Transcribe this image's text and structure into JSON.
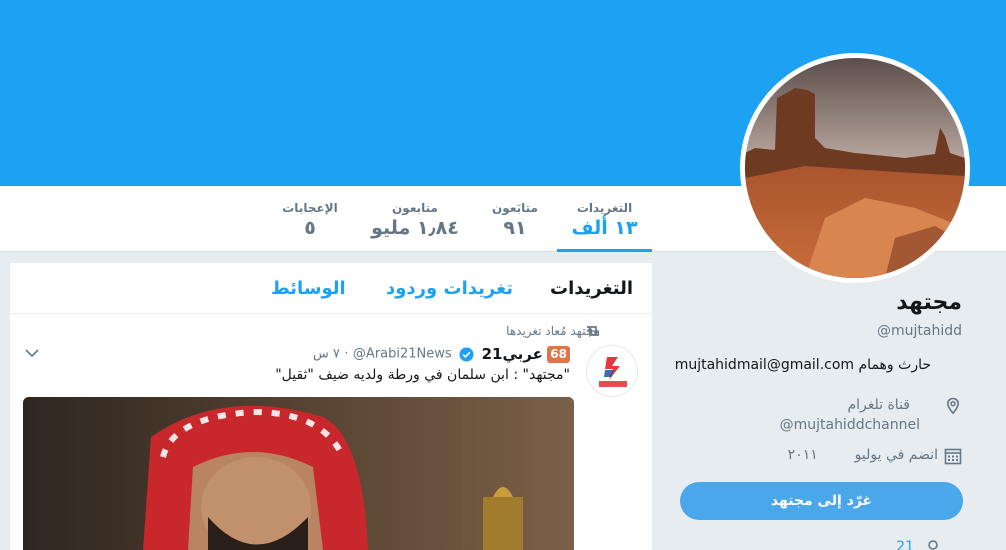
{
  "stats": {
    "tweets_label": "التغريدات",
    "tweets_value": "١٣ ألف",
    "following_label": "متابَعون",
    "following_value": "٩١",
    "followers_label": "متابعون",
    "followers_value": "١٫٨٤ مليو",
    "likes_label": "الإعجابات",
    "likes_value": "٥"
  },
  "profile": {
    "name": "مجتهد",
    "handle": "@mujtahidd",
    "bio": "حارث وهمام",
    "bio_email": "mujtahidmail@gmail.com",
    "location_line1": "قناة تلغرام",
    "location_line2": "@mujtahiddchannel",
    "joined_label": "انضم في يوليو",
    "joined_year": "٢٠١١",
    "tweet_button": "غرّد إلى مجتهد",
    "partial_row": "21"
  },
  "timeline": {
    "tabs": [
      "التغريدات",
      "تغريدات وردود",
      "الوسائط"
    ],
    "retweet_text": "مجتهد مُعاد تغريدها",
    "tweet": {
      "badge": "68",
      "name": "عربي21",
      "handle": "@Arabi21News",
      "time": "٧ س",
      "separator": "·",
      "text": "\"مجتهد\" : ابن سلمان في ورطة ولديه ضيف \"ثقيل\""
    }
  },
  "colors": {
    "accent": "#1da1f2",
    "button": "#4aa7ea",
    "muted": "#657786",
    "background": "#e6ecf0"
  }
}
